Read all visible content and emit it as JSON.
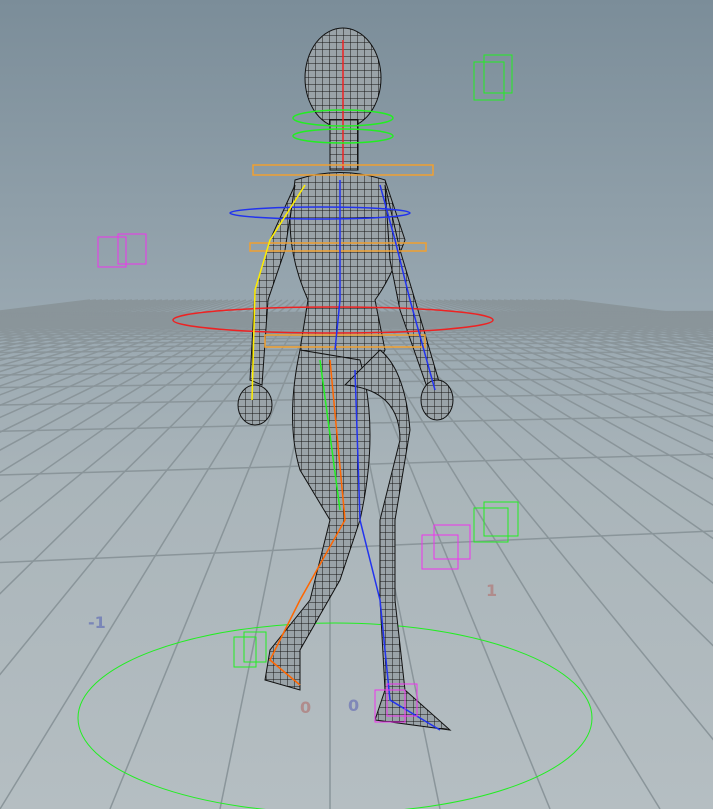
{
  "viewport": {
    "grid_labels": {
      "neg_x": "-1",
      "pos_x": "1",
      "origin_x": "0",
      "origin_z": "0"
    },
    "colors": {
      "grid": "#8c979c",
      "wire": "#111111",
      "green": "#22ee22",
      "magenta": "#ee33ee",
      "orange": "#f0a030",
      "red": "#ee2222",
      "blue": "#2233ee"
    }
  }
}
